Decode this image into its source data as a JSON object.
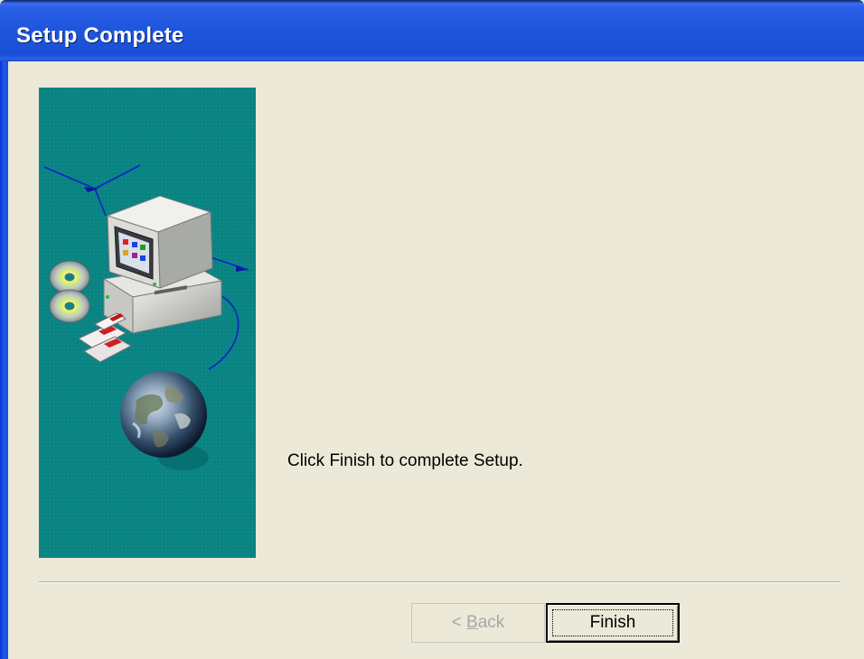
{
  "window": {
    "title": "Setup Complete"
  },
  "main": {
    "message": "Click Finish to complete Setup."
  },
  "buttons": {
    "back_label_prefix": "< ",
    "back_mnemonic": "B",
    "back_label_rest": "ack",
    "finish_label": "Finish"
  },
  "icons": {
    "illustration": "setup-computer-globe-illustration"
  },
  "colors": {
    "titlebar": "#0a246a",
    "dialog_bg": "#ece9d8",
    "illustration_bg": "#0b8484",
    "disabled_text": "#a7a6aa"
  }
}
